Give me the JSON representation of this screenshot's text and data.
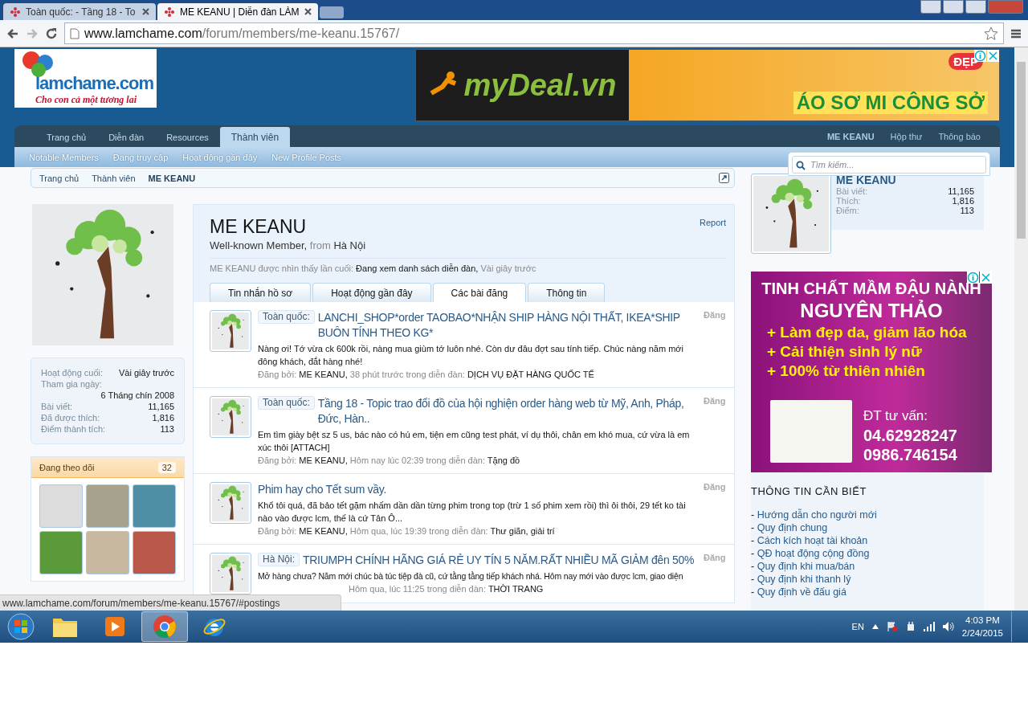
{
  "browser": {
    "tabs": [
      {
        "title": "Toàn quốc: - Tầng 18 - To",
        "selected": false
      },
      {
        "title": "ME KEANU | Diễn đàn LÀM",
        "selected": true
      }
    ],
    "url_host": "www.lamchame.com",
    "url_path": "/forum/members/me-keanu.15767/"
  },
  "header": {
    "logo": {
      "name": "lamchame.com",
      "tagline": "Cho con cả một tương lai"
    },
    "banner": {
      "brand": "myDeal.vn",
      "headline": "ÁO SƠ MI CÔNG SỞ",
      "badge": "ĐẸP"
    }
  },
  "nav": {
    "tabs": [
      {
        "label": "Trang chủ",
        "selected": false
      },
      {
        "label": "Diễn đàn",
        "selected": false
      },
      {
        "label": "Resources",
        "selected": false
      },
      {
        "label": "Thành viên",
        "selected": true
      }
    ],
    "user_links": [
      "ME KEANU",
      "Hộp thư",
      "Thông báo"
    ],
    "sub_links": [
      "Notable Members",
      "Đang truy cập",
      "Hoạt động gần đây",
      "New Profile Posts"
    ],
    "search": {
      "placeholder": "Tìm kiếm..."
    }
  },
  "breadcrumb": [
    "Trang chủ",
    "Thành viên",
    "ME KEANU"
  ],
  "sidebar": {
    "stats": [
      {
        "label": "Hoạt động cuối:",
        "value": "Vài giây trước"
      },
      {
        "label": "Tham gia ngày:",
        "value": "6 Tháng chín 2008"
      },
      {
        "label": "Bài viết:",
        "value": "11,165"
      },
      {
        "label": "Đã được thích:",
        "value": "1,816"
      },
      {
        "label": "Điểm thành tích:",
        "value": "113"
      }
    ],
    "following": {
      "title": "Đang theo dõi",
      "count": "32"
    }
  },
  "profile": {
    "name": "ME KEANU",
    "user_title": "Well-known Member,",
    "from_label": "from",
    "location": "Hà Nội",
    "report": "Report",
    "last_seen_label": "ME KEANU được nhìn thấy lần cuối:",
    "last_seen_activity": "Đang xem danh sách diễn đàn,",
    "last_seen_time": "Vài giây trước",
    "tabs": [
      {
        "label": "Tin nhắn hồ sơ",
        "selected": false
      },
      {
        "label": "Hoạt động gần đây",
        "selected": false
      },
      {
        "label": "Các bài đăng",
        "selected": true
      },
      {
        "label": "Thông tin",
        "selected": false
      }
    ],
    "posts": [
      {
        "prefix": "Toàn quốc:",
        "title": "LANCHI_SHOP*order TAOBAO*NHẬN SHIP HÀNG NỘI THẤT, IKEA*SHIP BUÔN TÍNH THEO KG*",
        "snippet": "Nàng ơi! Tớ vừa ck 600k rồi, nàng mua giùm tớ luôn nhé. Còn dư đâu đợt sau tính tiếp. Chúc nàng năm mới đông khách, đắt hàng nhé!",
        "meta_label": "Đăng bởi:",
        "author": "ME KEANU,",
        "time": "38 phút trước",
        "forum_label": "trong diễn đàn:",
        "forum": "DỊCH VỤ ĐẶT HÀNG QUỐC TẾ",
        "side": "Đăng"
      },
      {
        "prefix": "Toàn quốc:",
        "title": "Tầng 18 - Topic trao đổi đồ của hội nghiện order hàng web từ Mỹ, Anh, Pháp, Đức, Hàn..",
        "snippet": "Em tìm giày bệt sz 5 us, bác nào có hú em, tiện em cũng test phát, ví dụ thôi, chân em khó mua, cứ vừa là em xúc thôi [ATTACH]",
        "meta_label": "Đăng bởi:",
        "author": "ME KEANU,",
        "time": "Hôm nay lúc 02:39",
        "forum_label": "trong diễn đàn:",
        "forum": "Tặng đồ",
        "side": "Đăng"
      },
      {
        "title": "Phim hay cho Tết sum vầy.",
        "snippet": "Khổ tôi quá, đã bảo tết gặm nhấm dần dần từng phim trong top (trừ 1 số phim xem rồi) thì ôi thôi, 29 tết ko tài nào vào được lcm, thế là cứ Tân Ô...",
        "meta_label": "Đăng bởi:",
        "author": "ME KEANU,",
        "time": "Hôm qua, lúc 19:39",
        "forum_label": "trong diễn đàn:",
        "forum": "Thư giãn, giải trí",
        "side": "Đăng"
      },
      {
        "prefix": "Hà Nội:",
        "title": "TRIUMPH CHÍNH HÃNG GIÁ RẺ UY TÍN 5 NĂM.RẤT NHIỀU MÃ GIẢM đên 50%",
        "snippet": "Mở hàng chưa? Năm mới chúc bà túc tiệp đà cũ, cứ tằng tằng tiếp khách nhá. Hôm nay mới vào được lcm, giao diện",
        "time": "Hôm qua, lúc 11:25",
        "forum_label": "trong diễn đàn:",
        "forum": "THỜI TRANG",
        "side": "Đăng"
      }
    ]
  },
  "right": {
    "user": {
      "name": "ME KEANU",
      "stats": [
        {
          "label": "Bài viết:",
          "value": "11,165"
        },
        {
          "label": "Thích:",
          "value": "1,816"
        },
        {
          "label": "Điểm:",
          "value": "113"
        }
      ]
    },
    "ad": {
      "heading": [
        "TINH CHẤT MẦM ĐẬU NÀNH",
        "NGUYÊN THẢO"
      ],
      "benefits": [
        "+ Làm đẹp da, giảm lão hóa",
        "+ Cải thiện sinh lý nữ",
        "+ 100% từ thiên nhiên"
      ],
      "contact_label": "ĐT tư vấn:",
      "phones": [
        "04.62928247",
        "0986.746154"
      ]
    },
    "info": {
      "title": "THÔNG TIN CẦN BIẾT",
      "items": [
        {
          "marker": "-",
          "label": "Hướng dẫn cho người mới"
        },
        {
          "marker": "-",
          "label": "Quy định chung"
        },
        {
          "marker": "-",
          "label": "Cách kích hoạt tài khoản"
        },
        {
          "marker": "-",
          "label": "QĐ hoạt động cộng đồng"
        },
        {
          "marker": "-",
          "label": "Quy định khi mua/bán"
        },
        {
          "marker": "-",
          "label": "Quy định khi thanh lý"
        },
        {
          "marker": "-",
          "label": "Quy định về đấu giá"
        }
      ]
    }
  },
  "status_url": "www.lamchame.com/forum/members/me-keanu.15767/#postings",
  "taskbar": {
    "apps": [
      {
        "kind": "folder",
        "selected": false
      },
      {
        "kind": "media",
        "selected": false
      },
      {
        "kind": "chrome",
        "selected": true
      },
      {
        "kind": "ie",
        "selected": false
      }
    ],
    "language": "EN",
    "time": "4:03 PM",
    "date": "2/24/2015"
  }
}
